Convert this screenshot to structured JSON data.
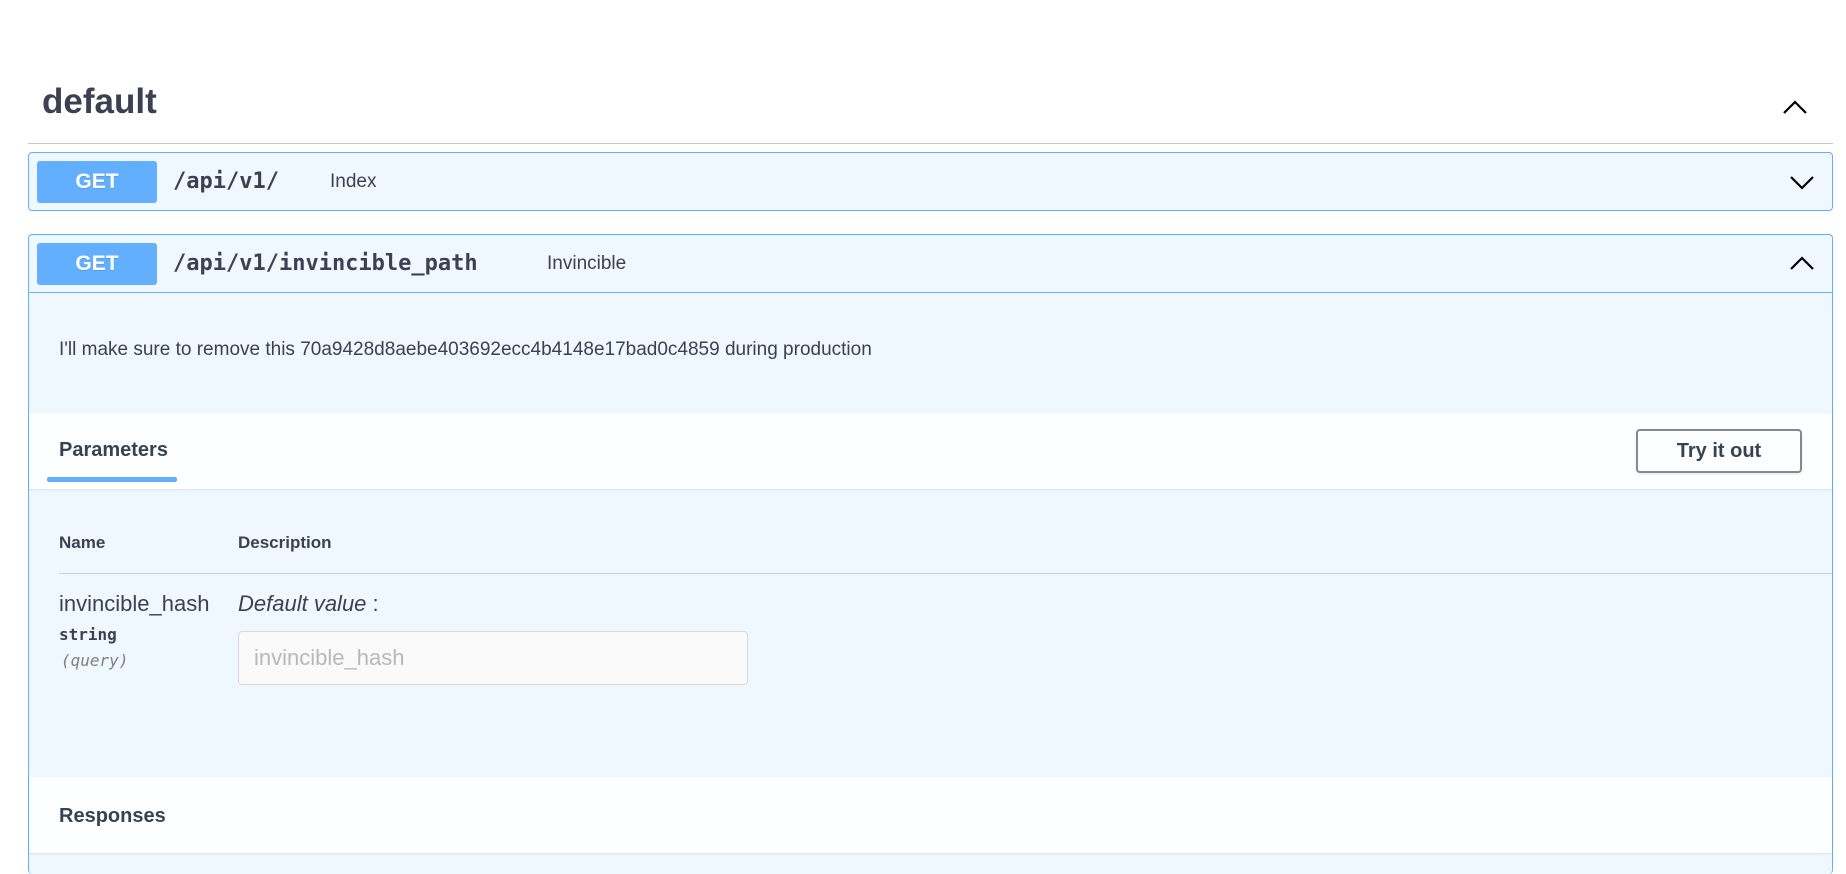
{
  "section": {
    "title": "default"
  },
  "operations": [
    {
      "method": "GET",
      "path": "/api/v1/",
      "summary": "Index",
      "expanded": false
    },
    {
      "method": "GET",
      "path": "/api/v1/invincible_path",
      "summary": "Invincible",
      "expanded": true,
      "description": "I'll make sure to remove this 70a9428d8aebe403692ecc4b4148e17bad0c4859 during production",
      "parameters_tab": "Parameters",
      "try_button": "Try it out",
      "table": {
        "name_header": "Name",
        "description_header": "Description"
      },
      "parameter": {
        "name": "invincible_hash",
        "type": "string",
        "in": "(query)",
        "default_label": "Default value",
        "default_suffix": " :",
        "placeholder": "invincible_hash"
      },
      "responses_label": "Responses"
    }
  ],
  "colors": {
    "get_method": "#61affe",
    "text": "#3b4151"
  },
  "icons": {
    "section_toggle": "chevron-up-icon",
    "op1_toggle": "chevron-down-icon",
    "op2_toggle": "chevron-up-icon"
  }
}
